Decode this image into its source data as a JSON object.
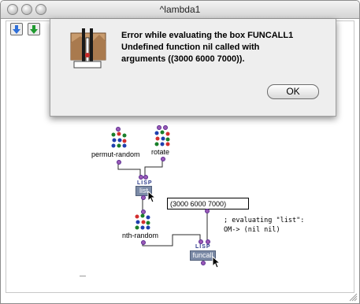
{
  "window": {
    "title": "^lambda1"
  },
  "toolbar": {
    "buttons": [
      {
        "name": "down-arrow-blue",
        "color": "#2f6fd8"
      },
      {
        "name": "down-arrow-green",
        "color": "#1f9a2f"
      }
    ]
  },
  "alert": {
    "message": "Error while evaluating the box FUNCALL1\nUndefined function nil called with\narguments ((3000 6000 7000)).",
    "ok_label": "OK"
  },
  "patch": {
    "boxes": [
      {
        "label": "permut-random"
      },
      {
        "label": "rotate"
      },
      {
        "label": "list",
        "tag": "LISP"
      },
      {
        "label": "nth-random"
      },
      {
        "label": "funcall",
        "tag": "LISP"
      }
    ],
    "input_value": "(3000 6000 7000)",
    "comment_line1": "; evaluating \"list\":",
    "comment_line2": "OM-> (nil nil)"
  },
  "colors": {
    "accent_blue": "#2f6fd8",
    "accent_green": "#1f9a2f",
    "lisp_box": "#7b8aa6",
    "connection": "#2b2b2b"
  }
}
